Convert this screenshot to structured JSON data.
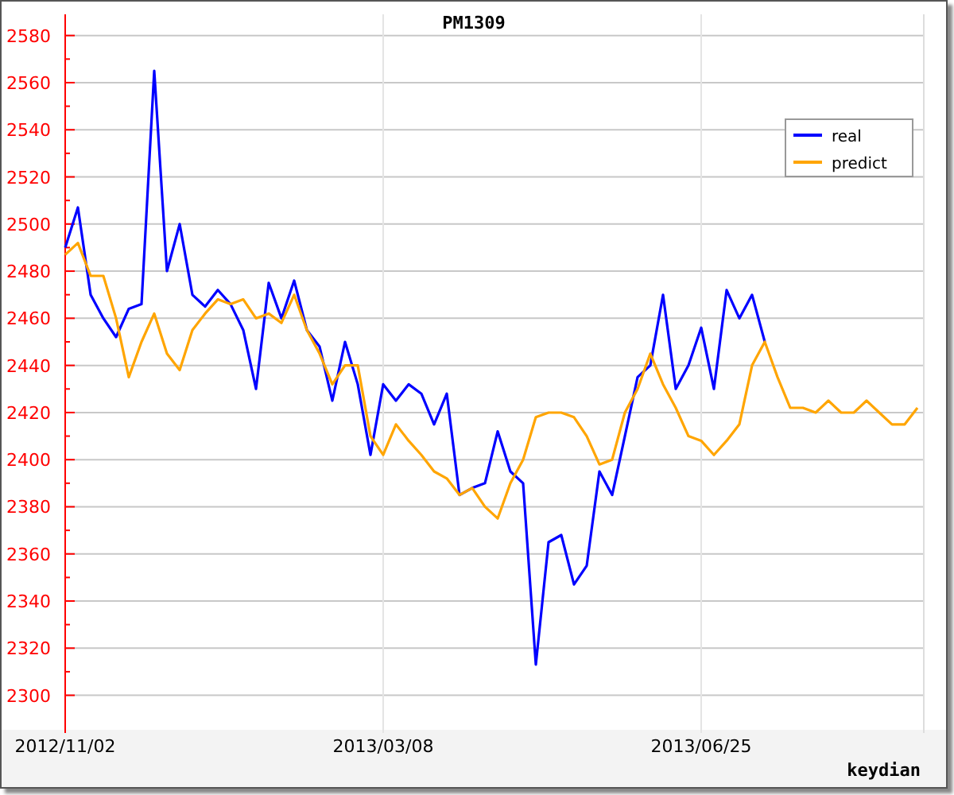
{
  "chart": {
    "credit": "keydian",
    "chart_data": {
      "type": "line",
      "title": "PM1309",
      "categories": [
        "2012/11/02",
        null,
        null,
        null,
        null,
        null,
        null,
        null,
        null,
        null,
        null,
        null,
        null,
        null,
        null,
        null,
        null,
        null,
        null,
        null,
        null,
        null,
        null,
        null,
        null,
        "2013/03/08",
        null,
        null,
        null,
        null,
        null,
        null,
        null,
        null,
        null,
        null,
        null,
        null,
        null,
        null,
        null,
        null,
        null,
        null,
        null,
        null,
        null,
        null,
        null,
        null,
        "2013/06/25",
        null,
        null,
        null,
        null,
        null,
        null,
        null,
        null,
        null,
        null,
        null,
        null,
        null,
        null,
        null,
        null,
        null
      ],
      "ylim": [
        2284,
        2589
      ],
      "grid": true,
      "legend": "upper right",
      "yticks": [
        2300,
        2320,
        2340,
        2360,
        2380,
        2400,
        2420,
        2440,
        2460,
        2480,
        2500,
        2520,
        2540,
        2560,
        2580
      ],
      "series": [
        {
          "name": "real",
          "color": "#0000ff",
          "values": [
            2490,
            2507,
            2470,
            2460,
            2452,
            2464,
            2466,
            2565,
            2480,
            2500,
            2470,
            2465,
            2472,
            2466,
            2455,
            2430,
            2475,
            2460,
            2476,
            2455,
            2448,
            2425,
            2450,
            2432,
            2402,
            2432,
            2425,
            2432,
            2428,
            2415,
            2428,
            2385,
            2388,
            2390,
            2412,
            2395,
            2390,
            2313,
            2365,
            2368,
            2347,
            2355,
            2395,
            2385,
            2410,
            2435,
            2440,
            2470,
            2430,
            2440,
            2456,
            2430,
            2472,
            2460,
            2470,
            2450,
            null,
            null,
            null,
            null,
            null,
            null,
            null,
            null,
            null,
            null,
            null,
            null
          ]
        },
        {
          "name": "predict",
          "color": "#ffa500",
          "values": [
            2487,
            2492,
            2478,
            2478,
            2460,
            2435,
            2450,
            2462,
            2445,
            2438,
            2455,
            2462,
            2468,
            2466,
            2468,
            2460,
            2462,
            2458,
            2470,
            2455,
            2445,
            2432,
            2440,
            2440,
            2410,
            2402,
            2415,
            2408,
            2402,
            2395,
            2392,
            2385,
            2388,
            2380,
            2375,
            2390,
            2400,
            2418,
            2420,
            2420,
            2418,
            2410,
            2398,
            2400,
            2420,
            2430,
            2445,
            2432,
            2422,
            2410,
            2408,
            2402,
            2408,
            2415,
            2440,
            2450,
            2435,
            2422,
            2422,
            2420,
            2425,
            2420,
            2420,
            2425,
            2420,
            2415,
            2415,
            2422
          ]
        }
      ]
    }
  }
}
